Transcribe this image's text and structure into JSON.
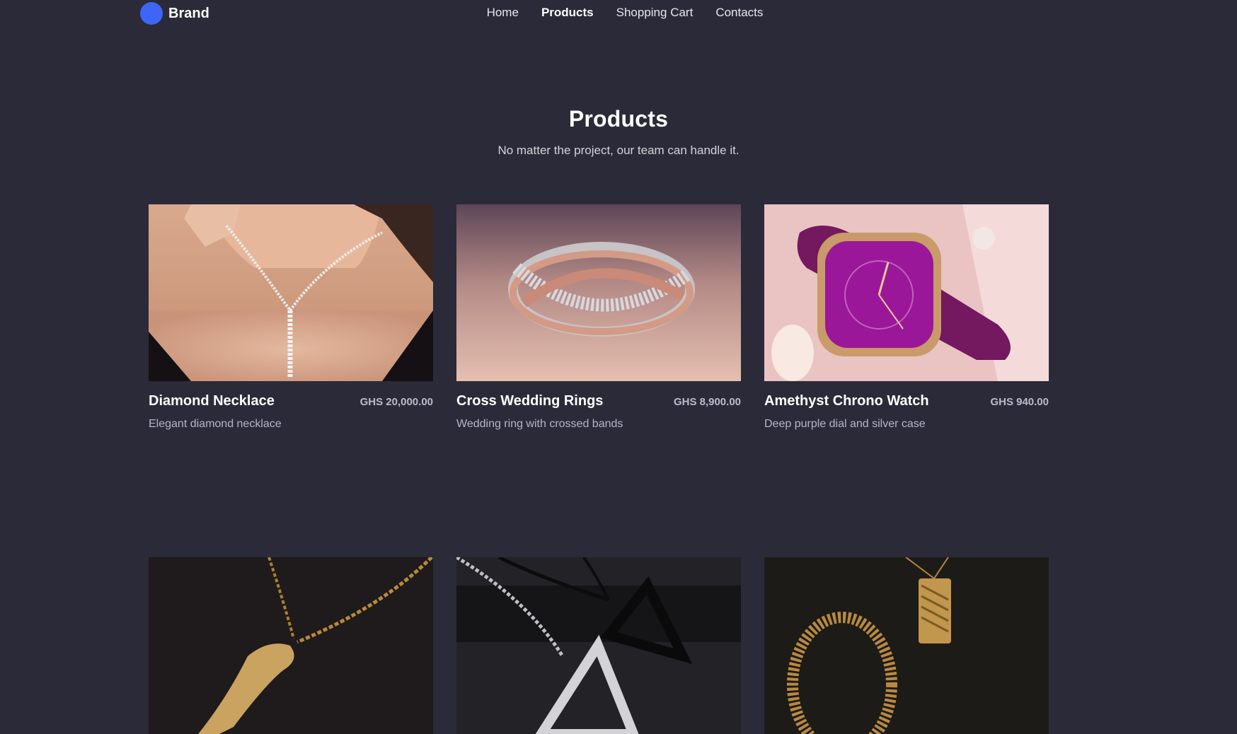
{
  "brand": {
    "name": "Brand",
    "accent": "#3d66f7"
  },
  "nav": {
    "items": [
      {
        "label": "Home",
        "active": false
      },
      {
        "label": "Products",
        "active": true
      },
      {
        "label": "Shopping Cart",
        "active": false
      },
      {
        "label": "Contacts",
        "active": false
      }
    ]
  },
  "hero": {
    "title": "Products",
    "subtitle": "No matter the project, our team can handle it."
  },
  "products": [
    {
      "title": "Diamond Necklace",
      "price": "GHS 20,000.00",
      "description": "Elegant diamond necklace",
      "image": "necklace-photo"
    },
    {
      "title": "Cross Wedding Rings",
      "price": "GHS 8,900.00",
      "description": "Wedding ring with crossed bands",
      "image": "ring-photo"
    },
    {
      "title": "Amethyst Chrono Watch",
      "price": "GHS 940.00",
      "description": "Deep purple dial and silver case",
      "image": "watch-photo"
    },
    {
      "image": "gold-pendant-photo"
    },
    {
      "image": "triangle-pendants-photo"
    },
    {
      "image": "gold-bracelet-photo"
    }
  ]
}
